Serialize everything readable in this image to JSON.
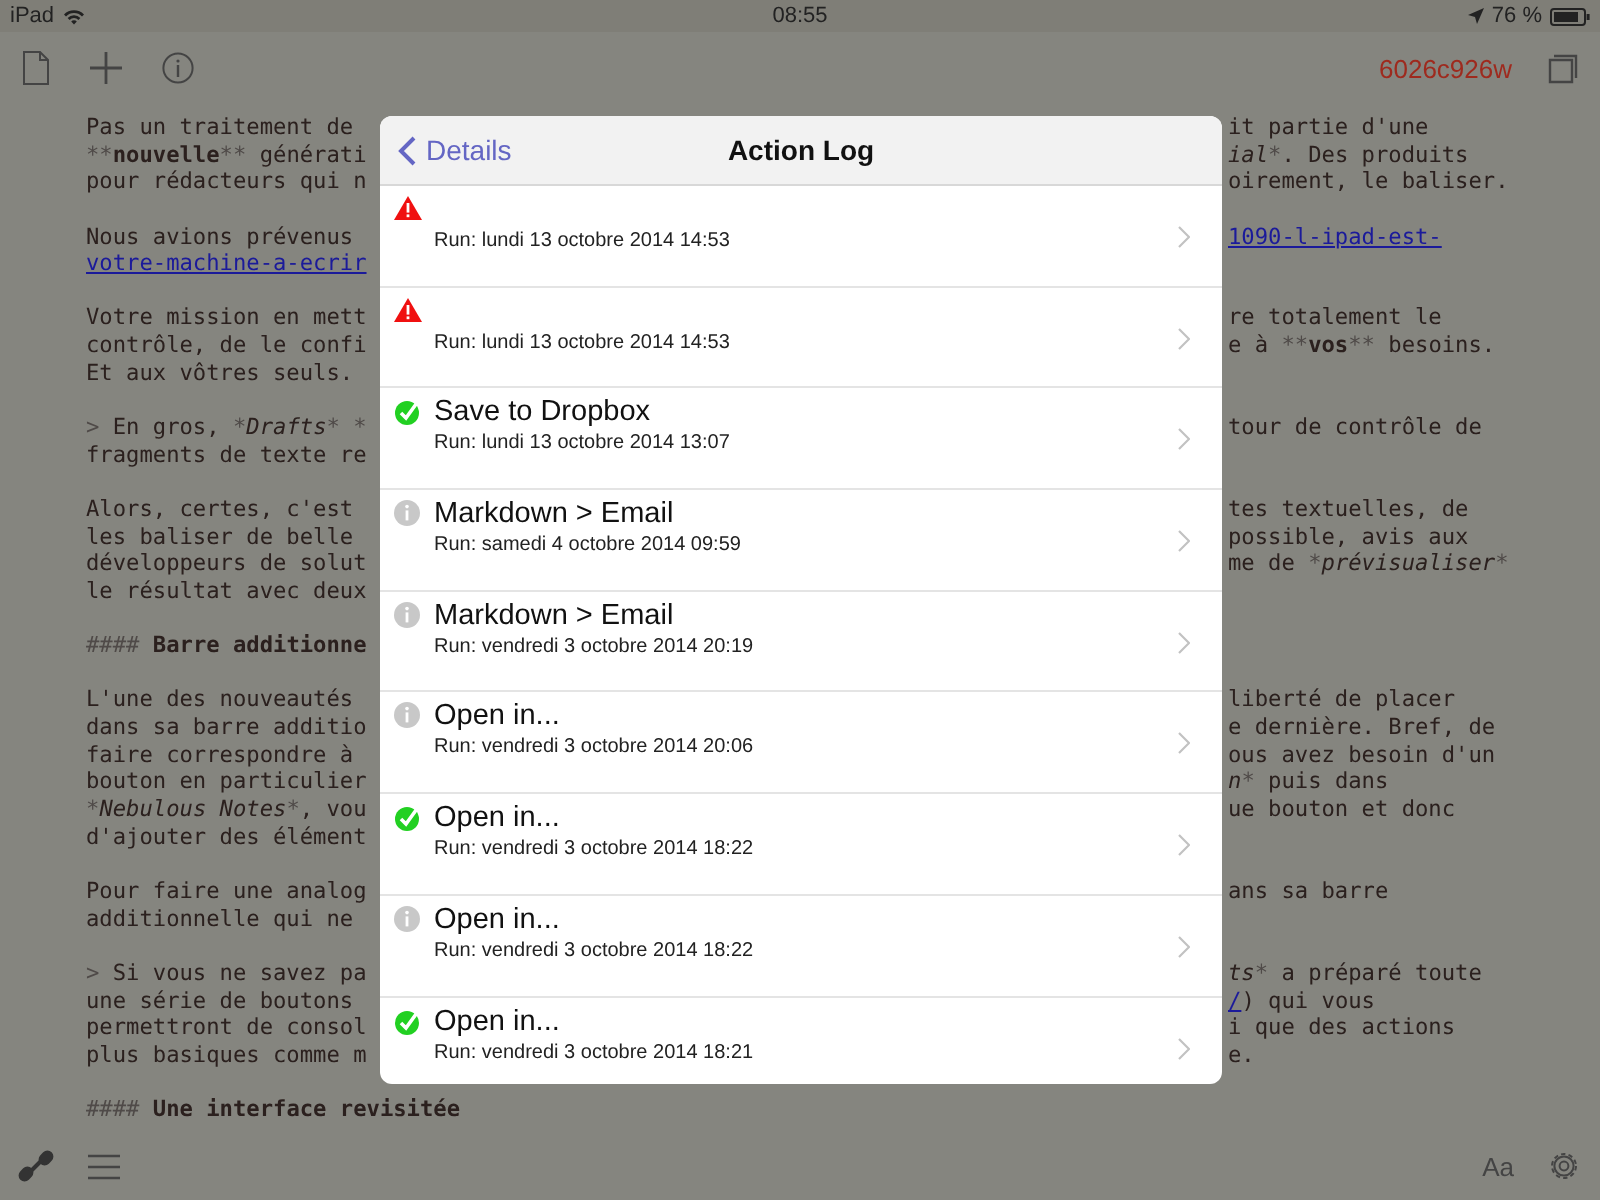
{
  "status_bar": {
    "device": "iPad",
    "time": "08:55",
    "battery": "76 %"
  },
  "toolbar": {
    "doc_id": "6026c926w"
  },
  "editor": {
    "paragraphs": [
      {
        "lines": [
          {
            "left": "Pas un traitement de ",
            "right": "it partie d'une"
          },
          {
            "left": [
              {
                "text": "**",
                "kind": "mark"
              },
              {
                "text": "nouvelle",
                "kind": "bold"
              },
              {
                "text": "**",
                "kind": "mark"
              },
              {
                "text": " générati",
                "kind": "plain"
              }
            ],
            "right": [
              {
                "text": "ial",
                "kind": "italic"
              },
              {
                "text": "*",
                "kind": "mark"
              },
              {
                "text": ". Des produits",
                "kind": "plain"
              }
            ]
          },
          {
            "left": "pour rédacteurs qui n",
            "right": "oirement, le baliser."
          }
        ]
      },
      {
        "lines": [
          {
            "left": "Nous avions prévenus ",
            "right": [
              {
                "text": "1090-l-ipad-est-",
                "kind": "link"
              }
            ]
          },
          {
            "left": [
              {
                "text": "votre-machine-a-ecrir",
                "kind": "link"
              }
            ]
          }
        ]
      },
      {
        "lines": [
          {
            "left": "Votre mission en mett",
            "right": "re totalement le"
          },
          {
            "left": "contrôle, de le confi",
            "right": [
              {
                "text": "e à ",
                "kind": "plain"
              },
              {
                "text": "**",
                "kind": "mark"
              },
              {
                "text": "vos",
                "kind": "bold"
              },
              {
                "text": "**",
                "kind": "mark"
              },
              {
                "text": " besoins.",
                "kind": "plain"
              }
            ]
          },
          {
            "left": "Et aux vôtres seuls."
          }
        ]
      },
      {
        "lines": [
          {
            "left": [
              {
                "text": "> ",
                "kind": "mark"
              },
              {
                "text": "En gros, ",
                "kind": "plain"
              },
              {
                "text": "*",
                "kind": "mark"
              },
              {
                "text": "Drafts",
                "kind": "italic"
              },
              {
                "text": "* *",
                "kind": "mark"
              }
            ],
            "right": "tour de contrôle de"
          },
          {
            "left": "fragments de texte re"
          }
        ]
      },
      {
        "lines": [
          {
            "left": "Alors, certes, c'est ",
            "right": "tes textuelles, de"
          },
          {
            "left": "les baliser de belle ",
            "right": "possible, avis aux"
          },
          {
            "left": "développeurs de solut",
            "right": [
              {
                "text": "me de ",
                "kind": "plain"
              },
              {
                "text": "*",
                "kind": "mark"
              },
              {
                "text": "prévisualiser",
                "kind": "italic"
              },
              {
                "text": "*",
                "kind": "mark"
              }
            ]
          },
          {
            "left": "le résultat avec deux"
          }
        ]
      },
      {
        "lines": [
          {
            "left": [
              {
                "text": "#### ",
                "kind": "mark"
              },
              {
                "text": "Barre additionne",
                "kind": "bold"
              }
            ]
          }
        ]
      },
      {
        "lines": [
          {
            "left": "L'une des nouveautés ",
            "right": "liberté de placer"
          },
          {
            "left": "dans sa barre additio",
            "right": "e dernière. Bref, de"
          },
          {
            "left": "faire correspondre à ",
            "right": "ous avez besoin d'un"
          },
          {
            "left": "bouton en particulier",
            "right": [
              {
                "text": "n",
                "kind": "italic"
              },
              {
                "text": "*",
                "kind": "mark"
              },
              {
                "text": " puis dans",
                "kind": "plain"
              }
            ]
          },
          {
            "left": [
              {
                "text": "*",
                "kind": "mark"
              },
              {
                "text": "Nebulous Notes",
                "kind": "italic"
              },
              {
                "text": "*",
                "kind": "mark"
              },
              {
                "text": ", vou",
                "kind": "plain"
              }
            ],
            "right": "ue bouton et donc"
          },
          {
            "left": "d'ajouter des élément"
          }
        ]
      },
      {
        "lines": [
          {
            "left": "Pour faire une analog",
            "right": "ans sa barre"
          },
          {
            "left": "additionnelle qui ne "
          }
        ]
      },
      {
        "lines": [
          {
            "left": [
              {
                "text": "> ",
                "kind": "mark"
              },
              {
                "text": "Si vous ne savez pa",
                "kind": "plain"
              }
            ],
            "right": [
              {
                "text": "ts",
                "kind": "italic"
              },
              {
                "text": "*",
                "kind": "mark"
              },
              {
                "text": " a préparé toute",
                "kind": "plain"
              }
            ]
          },
          {
            "left": "une série de boutons ",
            "right": [
              {
                "text": "/",
                "kind": "link"
              },
              {
                "text": ") qui vous",
                "kind": "plain"
              }
            ]
          },
          {
            "left": "permettront de consol",
            "right": "i que des actions"
          },
          {
            "left": "plus basiques comme m",
            "right": "e."
          }
        ]
      },
      {
        "lines": [
          {
            "left": [
              {
                "text": "#### ",
                "kind": "mark"
              },
              {
                "text": "Une interface revisitée",
                "kind": "bold"
              }
            ]
          }
        ]
      }
    ]
  },
  "bottom_bar": {
    "font_button": "Aa"
  },
  "action_log": {
    "back": "Details",
    "title": "Action Log",
    "rows": [
      {
        "kind": "error",
        "run": "Run: lundi 13 octobre 2014 14:53"
      },
      {
        "kind": "error",
        "run": "Run: lundi 13 octobre 2014 14:53"
      },
      {
        "kind": "success",
        "title": "Save to Dropbox",
        "run": "Run: lundi 13 octobre 2014 13:07"
      },
      {
        "kind": "info",
        "title": "Markdown > Email",
        "run": "Run: samedi 4 octobre 2014 09:59"
      },
      {
        "kind": "info",
        "title": "Markdown > Email",
        "run": "Run: vendredi 3 octobre 2014 20:19"
      },
      {
        "kind": "info",
        "title": "Open in...",
        "run": "Run: vendredi 3 octobre 2014 20:06"
      },
      {
        "kind": "success",
        "title": "Open in...",
        "run": "Run: vendredi 3 octobre 2014 18:22"
      },
      {
        "kind": "info",
        "title": "Open in...",
        "run": "Run: vendredi 3 octobre 2014 18:22"
      },
      {
        "kind": "success",
        "title": "Open in...",
        "run": "Run: vendredi 3 octobre 2014 18:21"
      }
    ]
  }
}
